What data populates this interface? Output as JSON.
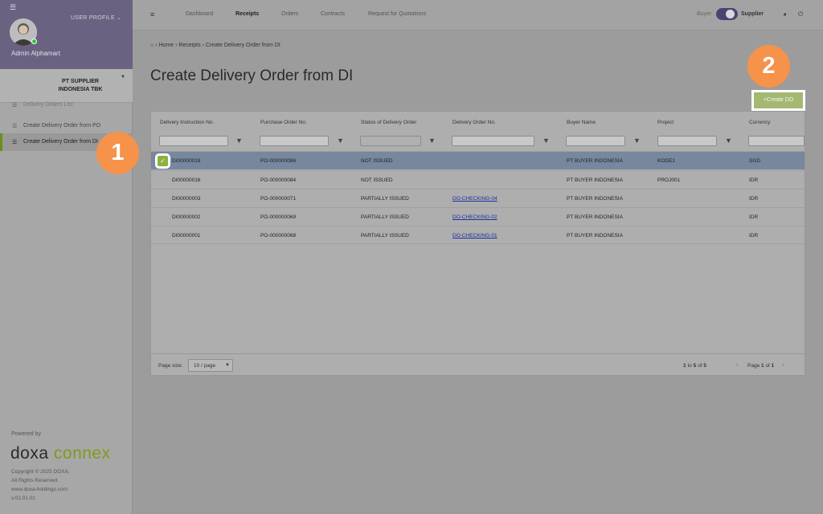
{
  "sidebar": {
    "menu_icon": "hamburger-icon",
    "profile_label": "USER PROFILE ⌄",
    "user_name": "Admin Alphamart",
    "company": "PT SUPPLIER INDONESIA TBK",
    "items": [
      {
        "label": "Delivery Orders List"
      },
      {
        "label": "Create Delivery Order from PO"
      },
      {
        "label": "Create Delivery Order from DI"
      }
    ],
    "powered_by": "Powered by",
    "logo_part1": "doxa",
    "logo_part2": "connex",
    "copyright": "Copyright © 2025 DOXA.",
    "rights": "All Rights Reserved.",
    "website": "www.doxa-holdings.com",
    "version": "v.02.01.01"
  },
  "topbar": {
    "nav": [
      {
        "label": "Dashboard",
        "active": false
      },
      {
        "label": "Receipts",
        "active": true
      },
      {
        "label": "Orders",
        "active": false
      },
      {
        "label": "Contracts",
        "active": false
      },
      {
        "label": "Request for Quotations",
        "active": false
      }
    ],
    "role_buyer": "Buyer",
    "role_supplier": "Supplier"
  },
  "breadcrumb": {
    "home": "Home",
    "receipts": "Receipts",
    "current": "Create Delivery Order from DI"
  },
  "page_title": "Create Delivery Order from DI",
  "create_button": "+Create DO",
  "grid": {
    "columns": [
      "Delivery Instruction No.",
      "Purchase Order No.",
      "Status of Delivery Order",
      "Delivery Order No.",
      "Buyer Name",
      "Project",
      "Currency"
    ],
    "rows": [
      {
        "di": "DI00000018",
        "po": "PO-000000086",
        "status": "NOT ISSUED",
        "do": "",
        "buyer": "PT BUYER INDONESIA",
        "project": "KODE1",
        "currency": "SGD",
        "selected": true
      },
      {
        "di": "DI00000016",
        "po": "PO-000000084",
        "status": "NOT ISSUED",
        "do": "",
        "buyer": "PT BUYER INDONESIA",
        "project": "PROJ001",
        "currency": "IDR",
        "selected": false
      },
      {
        "di": "DI00000003",
        "po": "PO-000000071",
        "status": "PARTIALLY ISSUED",
        "do": "DO-CHECKING-04",
        "buyer": "PT BUYER INDONESIA",
        "project": "",
        "currency": "IDR",
        "selected": false
      },
      {
        "di": "DI00000002",
        "po": "PO-000000069",
        "status": "PARTIALLY ISSUED",
        "do": "DO-CHECKING-02",
        "buyer": "PT BUYER INDONESIA",
        "project": "",
        "currency": "IDR",
        "selected": false
      },
      {
        "di": "DI00000001",
        "po": "PO-000000068",
        "status": "PARTIALLY ISSUED",
        "do": "DO-CHECKING-01",
        "buyer": "PT BUYER INDONESIA",
        "project": "",
        "currency": "IDR",
        "selected": false
      }
    ],
    "page_size_label": "Page size:",
    "page_size_value": "10 / page",
    "range_prefix": "1",
    "range_to": "to",
    "range_end": "5",
    "range_of": "of",
    "range_total": "5",
    "page_label": "Page",
    "page_current": "1",
    "page_of": "of",
    "page_total": "1"
  },
  "annotations": {
    "step1": "1",
    "step2": "2"
  },
  "colors": {
    "accent": "#6b6180",
    "primary_button": "#a4b872",
    "callout": "#f6924a",
    "link": "#1b2ea0"
  }
}
